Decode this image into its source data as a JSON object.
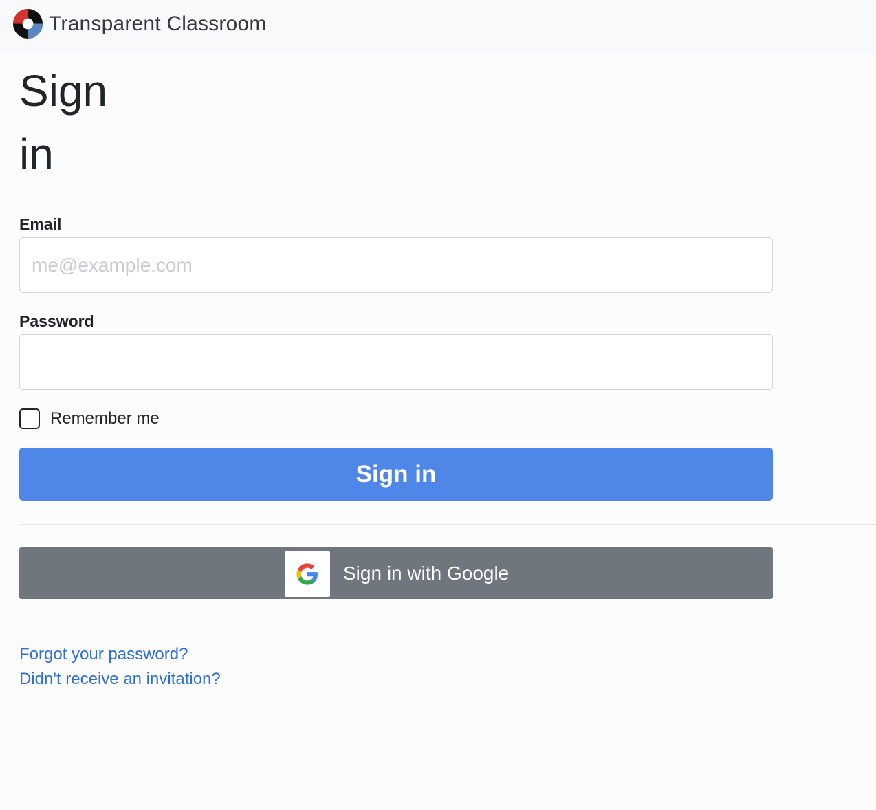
{
  "header": {
    "brand_name": "Transparent Classroom",
    "logo_icon": "transparent-classroom-logo",
    "logo_colors": [
      "#d4322c",
      "#101010",
      "#5a87bf"
    ]
  },
  "page": {
    "title": "Sign in"
  },
  "form": {
    "email": {
      "label": "Email",
      "placeholder": "me@example.com",
      "value": ""
    },
    "password": {
      "label": "Password",
      "value": ""
    },
    "remember_me": {
      "label": "Remember me",
      "checked": false
    },
    "submit_label": "Sign in"
  },
  "google": {
    "label": "Sign in with Google",
    "icon": "google-g-icon"
  },
  "links": {
    "forgot_password": "Forgot your password?",
    "no_invitation": "Didn't receive an invitation?"
  },
  "colors": {
    "primary": "#4f87e8",
    "google_button": "#6f767e",
    "link": "#2f6fd6"
  }
}
